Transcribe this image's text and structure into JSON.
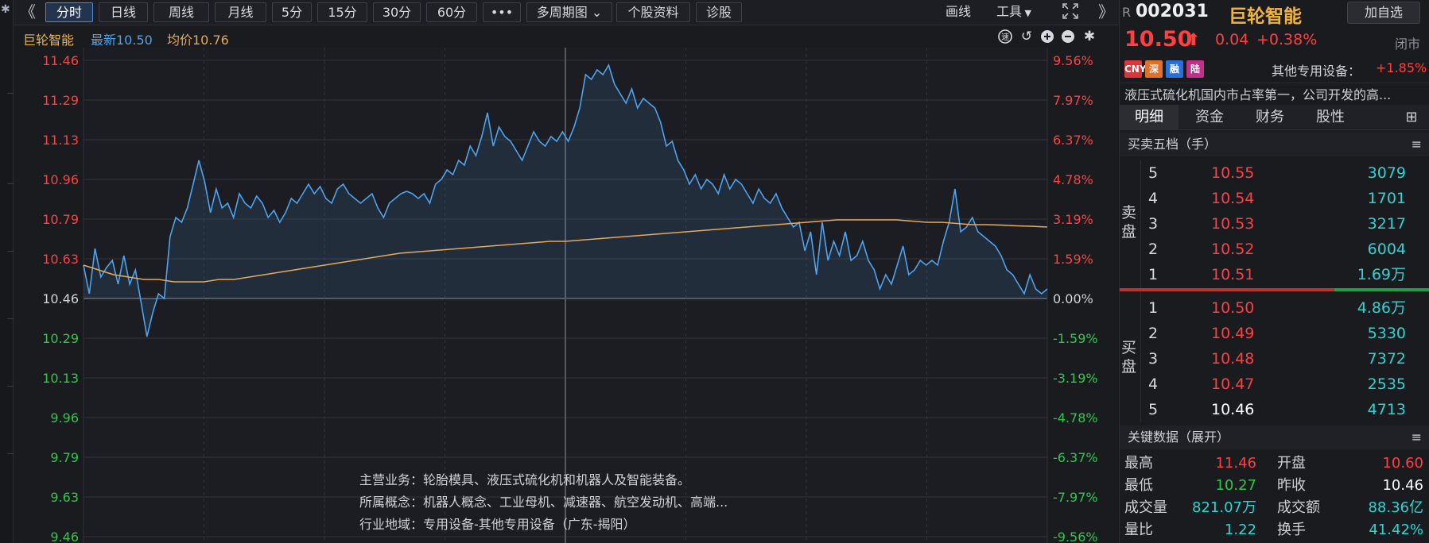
{
  "toolbar": {
    "collapse_left": "《",
    "tabs": [
      {
        "label": "分时",
        "active": true
      },
      {
        "label": "日线"
      },
      {
        "label": "周线"
      },
      {
        "label": "月线"
      },
      {
        "label": "5分"
      },
      {
        "label": "15分"
      },
      {
        "label": "30分"
      },
      {
        "label": "60分"
      },
      {
        "label": "•••"
      },
      {
        "label": "多周期图 ⌄"
      },
      {
        "label": "个股资料"
      },
      {
        "label": "诊股"
      }
    ],
    "draw_label": "画线",
    "tools_label": "工具",
    "expand_right": "》"
  },
  "chart_header": {
    "stock_name": "巨轮智能",
    "latest_label": "最新10.50",
    "avg_label": "均价10.76"
  },
  "colors": {
    "up": "#ff4040",
    "down": "#2ec84a",
    "price_line": "#4ea3ee",
    "avg_line": "#e6a85a",
    "cyan": "#2fd3d3",
    "orange": "#f0b43c"
  },
  "chart_data": {
    "type": "line",
    "title": "",
    "xlabel": "",
    "ylabel": "",
    "prev_close": 10.46,
    "ylim": [
      9.46,
      11.46
    ],
    "left_ticks": [
      "11.46",
      "11.29",
      "11.13",
      "10.96",
      "10.79",
      "10.63",
      "10.46",
      "10.29",
      "10.13",
      "9.96",
      "9.79",
      "9.63",
      "9.46"
    ],
    "right_ticks": [
      "9.56%",
      "7.97%",
      "6.37%",
      "4.78%",
      "3.19%",
      "1.59%",
      "0.00%",
      "-1.59%",
      "-3.19%",
      "-4.78%",
      "-6.37%",
      "-7.97%",
      "-9.56%"
    ],
    "series": [
      {
        "role": "price",
        "values": [
          10.6,
          10.48,
          10.67,
          10.55,
          10.59,
          10.62,
          10.52,
          10.64,
          10.52,
          10.58,
          10.44,
          10.3,
          10.4,
          10.48,
          10.46,
          10.72,
          10.8,
          10.78,
          10.84,
          10.94,
          11.04,
          10.95,
          10.82,
          10.92,
          10.84,
          10.86,
          10.8,
          10.9,
          10.86,
          10.84,
          10.89,
          10.86,
          10.8,
          10.83,
          10.78,
          10.82,
          10.88,
          10.86,
          10.9,
          10.94,
          10.9,
          10.93,
          10.88,
          10.86,
          10.92,
          10.94,
          10.9,
          10.88,
          10.86,
          10.88,
          10.9,
          10.84,
          10.8,
          10.86,
          10.88,
          10.9,
          10.91,
          10.9,
          10.88,
          10.9,
          10.86,
          10.94,
          10.96,
          11.0,
          10.98,
          11.04,
          11.02,
          11.1,
          11.06,
          11.14,
          11.24,
          11.1,
          11.18,
          11.14,
          11.12,
          11.08,
          11.04,
          11.1,
          11.16,
          11.12,
          11.1,
          11.14,
          11.12,
          11.16,
          11.12,
          11.18,
          11.26,
          11.4,
          11.38,
          11.42,
          11.4,
          11.44,
          11.36,
          11.32,
          11.28,
          11.34,
          11.26,
          11.3,
          11.28,
          11.26,
          11.2,
          11.1,
          11.12,
          11.04,
          11.0,
          10.94,
          10.98,
          10.92,
          10.96,
          10.94,
          10.9,
          10.98,
          10.92,
          10.96,
          10.94,
          10.9,
          10.86,
          10.92,
          10.88,
          10.86,
          10.9,
          10.84,
          10.8,
          10.76,
          10.78,
          10.66,
          10.74,
          10.56,
          10.78,
          10.62,
          10.7,
          10.64,
          10.74,
          10.62,
          10.64,
          10.7,
          10.62,
          10.58,
          10.5,
          10.56,
          10.52,
          10.6,
          10.68,
          10.56,
          10.58,
          10.62,
          10.6,
          10.62,
          10.6,
          10.7,
          10.78,
          10.92,
          10.74,
          10.76,
          10.8,
          10.74,
          10.72,
          10.7,
          10.68,
          10.64,
          10.58,
          10.56,
          10.52,
          10.48,
          10.56,
          10.5,
          10.48,
          10.5
        ]
      },
      {
        "role": "average",
        "values": [
          10.6,
          10.58,
          10.56,
          10.55,
          10.54,
          10.54,
          10.53,
          10.53,
          10.53,
          10.54,
          10.54,
          10.55,
          10.56,
          10.57,
          10.58,
          10.59,
          10.6,
          10.61,
          10.62,
          10.63,
          10.64,
          10.65,
          10.655,
          10.66,
          10.665,
          10.67,
          10.675,
          10.68,
          10.685,
          10.69,
          10.695,
          10.7,
          10.7,
          10.705,
          10.71,
          10.715,
          10.72,
          10.725,
          10.73,
          10.735,
          10.74,
          10.745,
          10.75,
          10.755,
          10.76,
          10.765,
          10.77,
          10.775,
          10.78,
          10.785,
          10.79,
          10.79,
          10.79,
          10.79,
          10.79,
          10.785,
          10.78,
          10.78,
          10.775,
          10.77,
          10.77,
          10.768,
          10.765,
          10.763,
          10.76
        ]
      }
    ]
  },
  "info_box": {
    "main_business": "主营业务：轮胎模具、液压式硫化机和机器人及智能装备。",
    "concepts": "所属概念：机器人概念、工业母机、减速器、航空发动机、高端...",
    "industry": "行业地域：专用设备-其他专用设备（广东-揭阳）"
  },
  "right_panel": {
    "r_badge": "R",
    "code": "002031",
    "name": "巨轮智能",
    "add_watch": "加自选",
    "price": "10.50",
    "up_arrow": "⬆",
    "change": "0.04",
    "change_pct": "+0.38%",
    "market_status": "闭市",
    "tags": [
      {
        "label": "CNY",
        "color": "#d9383a"
      },
      {
        "label": "深",
        "color": "#e0702a"
      },
      {
        "label": "融",
        "color": "#2a6fd6"
      },
      {
        "label": "陆",
        "color": "#c0308a"
      }
    ],
    "sector": "其他专用设备：",
    "sector_change": "+1.85%",
    "description": "液压式硫化机国内市占率第一，公司开发的高...",
    "tabs": [
      "明细",
      "资金",
      "财务",
      "股性"
    ],
    "tab_icon": "⊞",
    "orderbook_title": "买卖五档（手）",
    "sell_label": "卖盘",
    "buy_label": "买盘",
    "asks": [
      {
        "level": "5",
        "price": "10.55",
        "vol": "3079"
      },
      {
        "level": "4",
        "price": "10.54",
        "vol": "1701"
      },
      {
        "level": "3",
        "price": "10.53",
        "vol": "3217"
      },
      {
        "level": "2",
        "price": "10.52",
        "vol": "6004"
      },
      {
        "level": "1",
        "price": "10.51",
        "vol": "1.69万"
      }
    ],
    "bids": [
      {
        "level": "1",
        "price": "10.50",
        "vol": "4.86万"
      },
      {
        "level": "2",
        "price": "10.49",
        "vol": "5330"
      },
      {
        "level": "3",
        "price": "10.48",
        "vol": "7372"
      },
      {
        "level": "4",
        "price": "10.47",
        "vol": "2535"
      },
      {
        "level": "5",
        "price": "10.46",
        "vol": "4713"
      }
    ],
    "keydata_title": "关键数据（展开）",
    "keydata": [
      {
        "l1": "最高",
        "v1": "11.46",
        "c1": "up",
        "l2": "开盘",
        "v2": "10.60",
        "c2": "up"
      },
      {
        "l1": "最低",
        "v1": "10.27",
        "c1": "down",
        "l2": "昨收",
        "v2": "10.46",
        "c2": "white"
      },
      {
        "l1": "成交量",
        "v1": "821.07万",
        "c1": "cyan",
        "l2": "成交额",
        "v2": "88.36亿",
        "c2": "cyan"
      },
      {
        "l1": "量比",
        "v1": "1.22",
        "c1": "cyan",
        "l2": "换手",
        "v2": "41.42%",
        "c2": "cyan"
      }
    ]
  }
}
